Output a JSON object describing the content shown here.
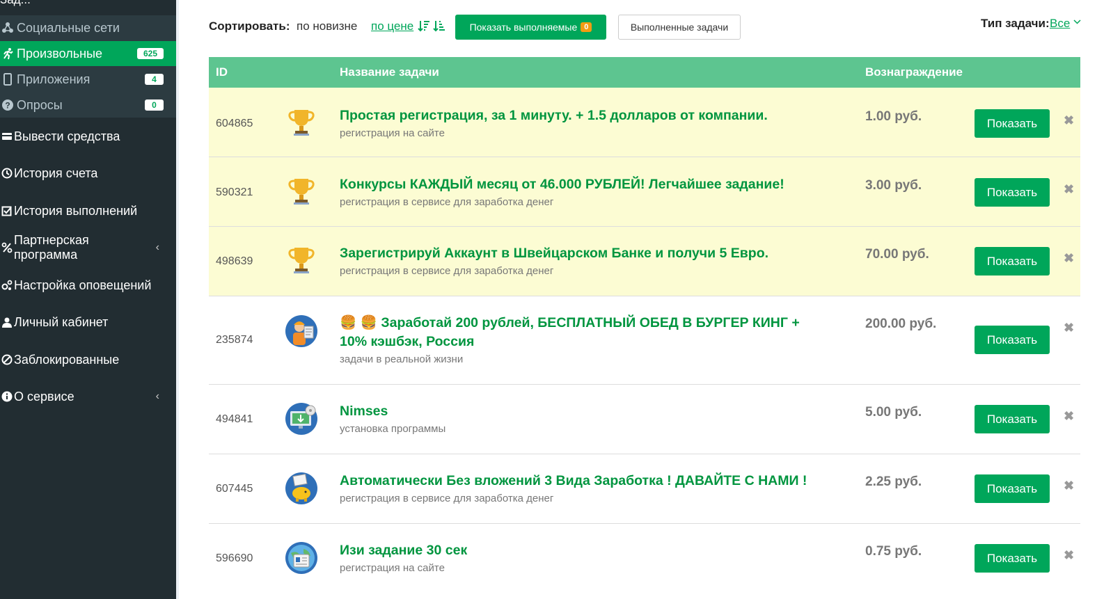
{
  "sidebar": {
    "cut_label": "Зад...",
    "sub_items": [
      {
        "label": "Социальные сети",
        "icon": "network-icon",
        "badge": "",
        "active": false
      },
      {
        "label": "Произвольные",
        "icon": "runner-icon",
        "badge": "625",
        "active": true
      },
      {
        "label": "Приложения",
        "icon": "mobile-icon",
        "badge": "4",
        "active": false
      },
      {
        "label": "Опросы",
        "icon": "question-icon",
        "badge": "0",
        "active": false
      }
    ],
    "nav_items": [
      {
        "label": "Вывести средства",
        "icon": "wallet-icon",
        "chevron": ""
      },
      {
        "label": "История счета",
        "icon": "history-icon",
        "chevron": ""
      },
      {
        "label": "История выполнений",
        "icon": "checkbox-icon",
        "chevron": ""
      },
      {
        "label": "Партнерская программа",
        "icon": "percent-icon",
        "chevron": "‹"
      },
      {
        "label": "Настройка оповещений",
        "icon": "cogs-icon",
        "chevron": ""
      },
      {
        "label": "Личный кабинет",
        "icon": "user-icon",
        "chevron": ""
      },
      {
        "label": "Заблокированные",
        "icon": "ban-icon",
        "chevron": ""
      },
      {
        "label": "О сервисе",
        "icon": "info-icon",
        "chevron": "‹"
      }
    ]
  },
  "toolbar": {
    "sort_label": "Сортировать:",
    "sort_newest": "по новизне",
    "sort_price": "по цене",
    "show_active_label": "Показать выполняемые",
    "show_active_count": "0",
    "done_tasks_label": "Выполненные задачи",
    "type_label": "Тип задачи:",
    "type_value": "Все"
  },
  "table": {
    "headers": {
      "id": "ID",
      "name": "Название задачи",
      "reward": "Вознаграждение"
    },
    "rows": [
      {
        "id": "604865",
        "icon": "trophy-icon",
        "title": "Простая регистрация, за 1 минуту. + 1.5 долларов от компании.",
        "subtitle": "регистрация на сайте",
        "reward": "1.00 руб.",
        "button": "Показать",
        "highlight": true
      },
      {
        "id": "590321",
        "icon": "trophy-icon",
        "title": "Конкурсы КАЖДЫЙ месяц от 46.000 РУБЛЕЙ! Легчайшее задание!",
        "subtitle": "регистрация в сервисе для заработка денег",
        "reward": "3.00 руб.",
        "button": "Показать",
        "highlight": true
      },
      {
        "id": "498639",
        "icon": "trophy-icon",
        "title": "Зарегистрируй Аккаунт в Швейцарском Банке и получи 5 Евро.",
        "subtitle": "регистрация в сервисе для заработка денег",
        "reward": "70.00 руб.",
        "button": "Показать",
        "highlight": true
      },
      {
        "id": "235874",
        "icon": "worker-icon",
        "title": "🍔 🍔 Заработай 200 рублей, БЕСПЛАТНЫЙ ОБЕД В БУРГЕР КИНГ + 10% кэшбэк, Россия",
        "subtitle": "задачи в реальной жизни",
        "reward": "200.00 руб.",
        "button": "Показать",
        "highlight": false
      },
      {
        "id": "494841",
        "icon": "monitor-download-icon",
        "title": "Nimses",
        "subtitle": "установка программы",
        "reward": "5.00 руб.",
        "button": "Показать",
        "highlight": false
      },
      {
        "id": "607445",
        "icon": "piggy-bank-icon",
        "title": "Автоматически Без вложений 3 Вида Заработка ! ДАВАЙТЕ С НАМИ !",
        "subtitle": "регистрация в сервисе для заработка денег",
        "reward": "2.25 руб.",
        "button": "Показать",
        "highlight": false
      },
      {
        "id": "596690",
        "icon": "id-card-globe-icon",
        "title": "Изи задание 30 сек",
        "subtitle": "регистрация на сайте",
        "reward": "0.75 руб.",
        "button": "Показать",
        "highlight": false
      }
    ]
  },
  "colors": {
    "accent": "#00a65a",
    "header": "#5dc590",
    "highlight": "#fcfcd3",
    "sidebar": "#222d32"
  }
}
